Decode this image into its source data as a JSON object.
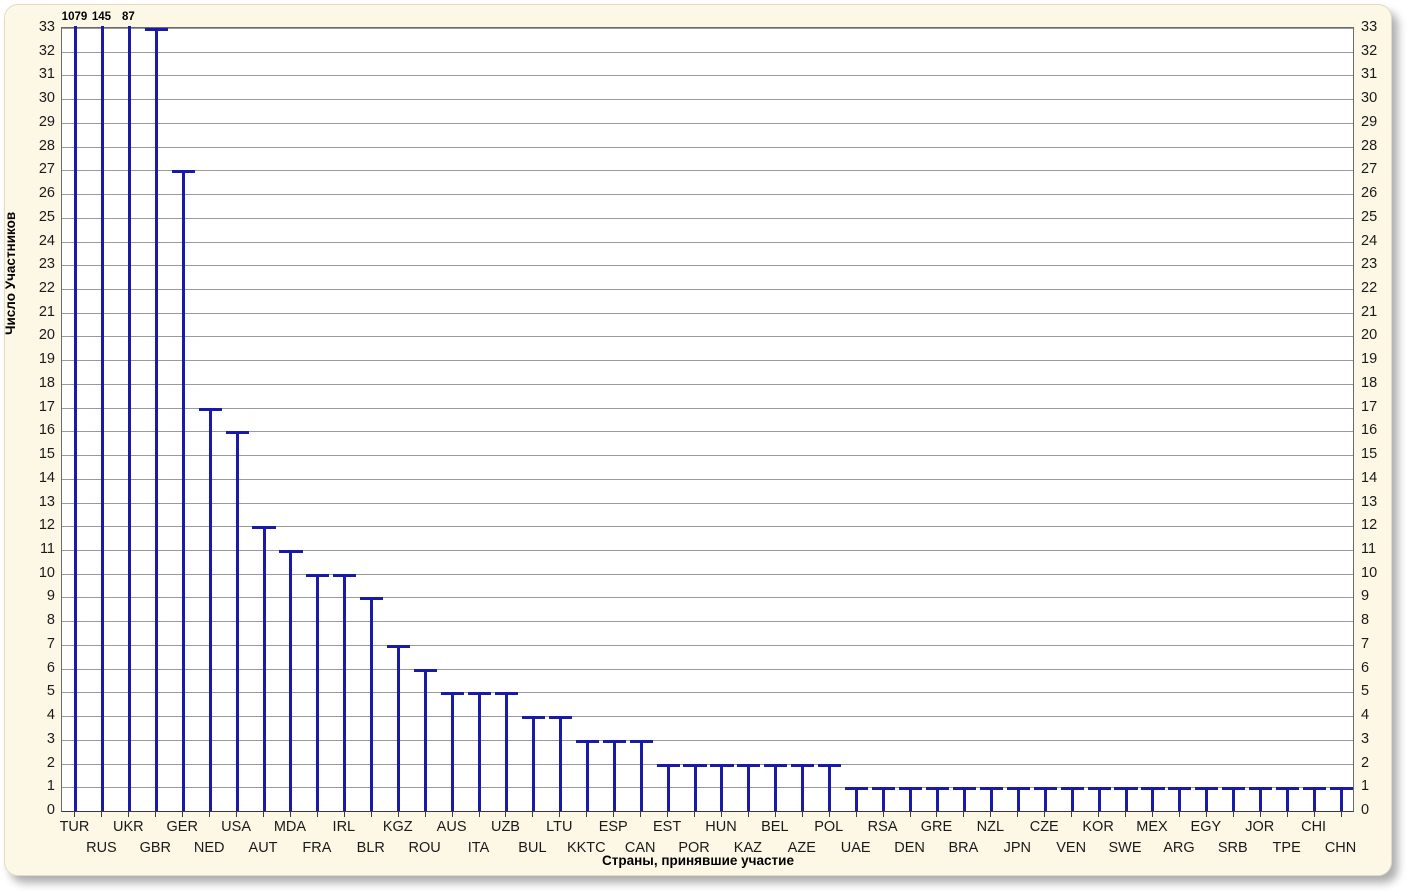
{
  "chart_data": {
    "type": "bar",
    "title": "",
    "xlabel": "Страны, принявшие участие",
    "ylabel": "Число Участников",
    "ylim": [
      0,
      33
    ],
    "ytick_step": 1,
    "grid": true,
    "legend": null,
    "bar_color": "#1a1aa8",
    "plot_background": "#ffffff",
    "page_background": "#fdf8e6",
    "overflow_note": "First three bars exceed the axis maximum; their true values are printed above the plot area.",
    "categories": [
      "TUR",
      "RUS",
      "UKR",
      "GBR",
      "GER",
      "NED",
      "USA",
      "AUT",
      "MDA",
      "FRA",
      "IRL",
      "BLR",
      "KGZ",
      "ROU",
      "AUS",
      "ITA",
      "UZB",
      "BUL",
      "LTU",
      "KKTC",
      "ESP",
      "CAN",
      "EST",
      "POR",
      "HUN",
      "KAZ",
      "BEL",
      "AZE",
      "POL",
      "UAE",
      "RSA",
      "DEN",
      "GRE",
      "BRA",
      "NZL",
      "JPN",
      "CZE",
      "VEN",
      "KOR",
      "SWE",
      "MEX",
      "ARG",
      "EGY",
      "SRB",
      "JOR",
      "TPE",
      "CHI",
      "CHN"
    ],
    "values": [
      1079,
      145,
      87,
      33,
      27,
      17,
      16,
      12,
      11,
      10,
      10,
      9,
      7,
      6,
      5,
      5,
      5,
      4,
      4,
      3,
      3,
      3,
      2,
      2,
      2,
      2,
      2,
      2,
      2,
      1,
      1,
      1,
      1,
      1,
      1,
      1,
      1,
      1,
      1,
      1,
      1,
      1,
      1,
      1,
      1,
      1,
      1,
      1
    ],
    "overflow_labels": [
      {
        "category": "TUR",
        "value": 1079
      },
      {
        "category": "RUS",
        "value": 145
      },
      {
        "category": "UKR",
        "value": 87
      }
    ],
    "yticks": [
      "0",
      "1",
      "2",
      "3",
      "4",
      "5",
      "6",
      "7",
      "8",
      "9",
      "10",
      "11",
      "12",
      "13",
      "14",
      "15",
      "16",
      "17",
      "18",
      "19",
      "20",
      "21",
      "22",
      "23",
      "24",
      "25",
      "26",
      "27",
      "28",
      "29",
      "30",
      "31",
      "32",
      "33"
    ],
    "xtick_row_top": [
      "TUR",
      "UKR",
      "GER",
      "USA",
      "MDA",
      "IRL",
      "KGZ",
      "AUS",
      "UZB",
      "LTU",
      "ESP",
      "EST",
      "HUN",
      "BEL",
      "POL",
      "RSA",
      "GRE",
      "NZL",
      "CZE",
      "KOR",
      "MEX",
      "EGY",
      "JOR",
      "CHI"
    ],
    "xtick_row_bottom": [
      "RUS",
      "GBR",
      "NED",
      "AUT",
      "FRA",
      "BLR",
      "ROU",
      "ITA",
      "BUL",
      "KKTC",
      "CAN",
      "POR",
      "KAZ",
      "AZE",
      "UAE",
      "DEN",
      "BRA",
      "JPN",
      "VEN",
      "SWE",
      "ARG",
      "SRB",
      "TPE",
      "CHN"
    ]
  }
}
